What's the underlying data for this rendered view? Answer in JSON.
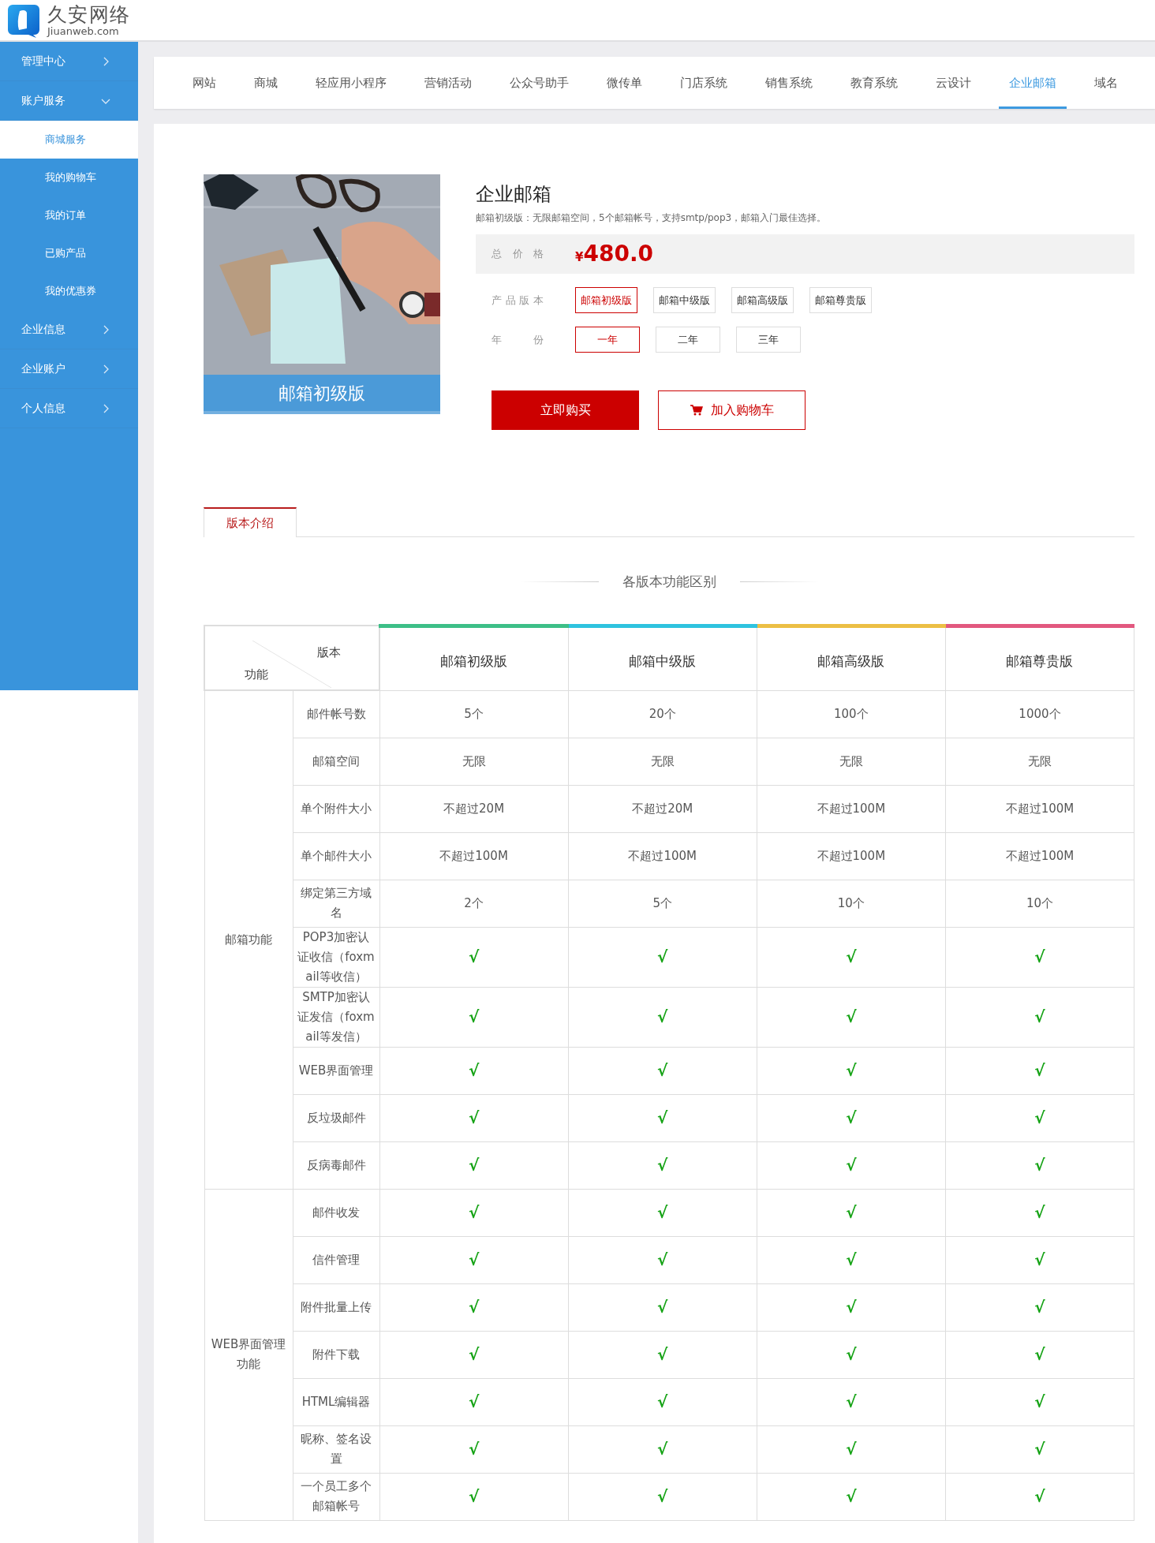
{
  "logo": {
    "name": "久安网络",
    "domain": "Jiuanweb.com"
  },
  "sidebar": {
    "items": [
      {
        "label": "管理中心",
        "expanded": false
      },
      {
        "label": "账户服务",
        "expanded": true,
        "children": [
          {
            "label": "商城服务",
            "selected": true
          },
          {
            "label": "我的购物车",
            "selected": false
          },
          {
            "label": "我的订单",
            "selected": false
          },
          {
            "label": "已购产品",
            "selected": false
          },
          {
            "label": "我的优惠券",
            "selected": false
          }
        ]
      },
      {
        "label": "企业信息",
        "expanded": false
      },
      {
        "label": "企业账户",
        "expanded": false
      },
      {
        "label": "个人信息",
        "expanded": false
      }
    ]
  },
  "nav_tabs": [
    {
      "label": "网站",
      "selected": false
    },
    {
      "label": "商城",
      "selected": false
    },
    {
      "label": "轻应用小程序",
      "selected": false
    },
    {
      "label": "营销活动",
      "selected": false
    },
    {
      "label": "公众号助手",
      "selected": false
    },
    {
      "label": "微传单",
      "selected": false
    },
    {
      "label": "门店系统",
      "selected": false
    },
    {
      "label": "销售系统",
      "selected": false
    },
    {
      "label": "教育系统",
      "selected": false
    },
    {
      "label": "云设计",
      "selected": false
    },
    {
      "label": "企业邮箱",
      "selected": true
    },
    {
      "label": "域名",
      "selected": false
    }
  ],
  "product": {
    "image_caption": "邮箱初级版",
    "title": "企业邮箱",
    "description": "邮箱初级版：无限邮箱空间，5个邮箱帐号，支持smtp/pop3，邮箱入门最佳选择。",
    "price_label": "总价格",
    "currency": "¥",
    "price": "480.0",
    "options": [
      {
        "label": "产品版本",
        "choices": [
          {
            "label": "邮箱初级版",
            "selected": true
          },
          {
            "label": "邮箱中级版",
            "selected": false
          },
          {
            "label": "邮箱高级版",
            "selected": false
          },
          {
            "label": "邮箱尊贵版",
            "selected": false
          }
        ]
      },
      {
        "label": "年份",
        "choices": [
          {
            "label": "一年",
            "selected": true
          },
          {
            "label": "二年",
            "selected": false
          },
          {
            "label": "三年",
            "selected": false
          }
        ]
      }
    ],
    "buy_button": "立即购买",
    "cart_button": "加入购物车"
  },
  "detail_tabs": [
    {
      "label": "版本介绍",
      "selected": true
    }
  ],
  "section_title": "各版本功能区别",
  "table": {
    "corner": {
      "column_label": "版本",
      "row_label": "功能"
    },
    "columns": [
      {
        "label": "邮箱初级版",
        "color": "#3dbf87"
      },
      {
        "label": "邮箱中级版",
        "color": "#2ec3df"
      },
      {
        "label": "邮箱高级版",
        "color": "#ecbf45"
      },
      {
        "label": "邮箱尊贵版",
        "color": "#e2587f"
      }
    ],
    "groups": [
      {
        "label": "邮箱功能",
        "rows": [
          {
            "feature": "邮件帐号数",
            "kind": "text",
            "values": [
              "5个",
              "20个",
              "100个",
              "1000个"
            ]
          },
          {
            "feature": "邮箱空间",
            "kind": "text",
            "values": [
              "无限",
              "无限",
              "无限",
              "无限"
            ]
          },
          {
            "feature": "单个附件大小",
            "kind": "text",
            "values": [
              "不超过20M",
              "不超过20M",
              "不超过100M",
              "不超过100M"
            ]
          },
          {
            "feature": "单个邮件大小",
            "kind": "text",
            "values": [
              "不超过100M",
              "不超过100M",
              "不超过100M",
              "不超过100M"
            ]
          },
          {
            "feature": "绑定第三方域名",
            "kind": "text",
            "values": [
              "2个",
              "5个",
              "10个",
              "10个"
            ]
          },
          {
            "feature": "POP3加密认证收信（foxmail等收信）",
            "kind": "check",
            "values": [
              "√",
              "√",
              "√",
              "√"
            ]
          },
          {
            "feature": "SMTP加密认证发信（foxmail等发信）",
            "kind": "check",
            "values": [
              "√",
              "√",
              "√",
              "√"
            ]
          },
          {
            "feature": "WEB界面管理",
            "kind": "check",
            "values": [
              "√",
              "√",
              "√",
              "√"
            ]
          },
          {
            "feature": "反垃圾邮件",
            "kind": "check",
            "values": [
              "√",
              "√",
              "√",
              "√"
            ]
          },
          {
            "feature": "反病毒邮件",
            "kind": "check",
            "values": [
              "√",
              "√",
              "√",
              "√"
            ]
          }
        ]
      },
      {
        "label": "WEB界面管理功能",
        "rows": [
          {
            "feature": "邮件收发",
            "kind": "check",
            "values": [
              "√",
              "√",
              "√",
              "√"
            ]
          },
          {
            "feature": "信件管理",
            "kind": "check",
            "values": [
              "√",
              "√",
              "√",
              "√"
            ]
          },
          {
            "feature": "附件批量上传",
            "kind": "check",
            "values": [
              "√",
              "√",
              "√",
              "√"
            ]
          },
          {
            "feature": "附件下载",
            "kind": "check",
            "values": [
              "√",
              "√",
              "√",
              "√"
            ]
          },
          {
            "feature": "HTML编辑器",
            "kind": "check",
            "values": [
              "√",
              "√",
              "√",
              "√"
            ]
          },
          {
            "feature": "昵称、签名设置",
            "kind": "check",
            "values": [
              "√",
              "√",
              "√",
              "√"
            ]
          },
          {
            "feature": "一个员工多个邮箱帐号",
            "kind": "check",
            "values": [
              "√",
              "√",
              "√",
              "√"
            ]
          }
        ]
      }
    ]
  }
}
